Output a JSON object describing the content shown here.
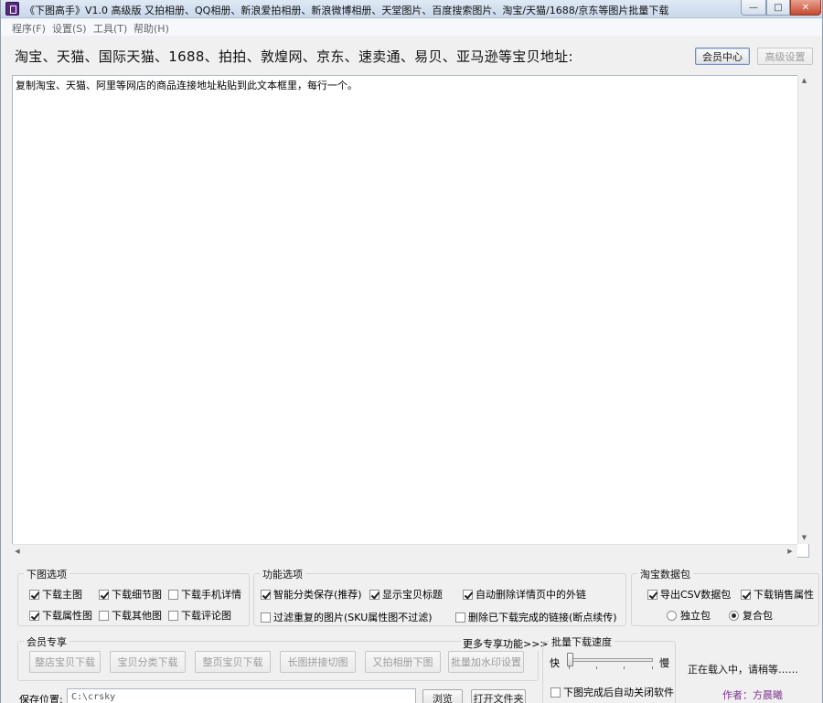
{
  "window": {
    "title": "《下图高手》V1.0  高级版  又拍相册、QQ相册、新浪爱拍相册、新浪微博相册、天堂图片、百度搜索图片、淘宝/天猫/1688/京东等图片批量下载",
    "controls": {
      "minimize": "—",
      "maximize": "□",
      "close": "✕"
    }
  },
  "menu": [
    "程序(F)",
    "设置(S)",
    "工具(T)",
    "帮助(H)"
  ],
  "header": {
    "url_label": "淘宝、天猫、国际天猫、1688、拍拍、敦煌网、京东、速卖通、易贝、亚马逊等宝贝地址:",
    "member_center": "会员中心",
    "advanced_settings": "高级设置"
  },
  "editor": {
    "text": "复制淘宝、天猫、阿里等网店的商品连接地址粘贴到此文本框里，每行一个。",
    "scroll_up": "▲",
    "scroll_down": "▼",
    "scroll_left": "◀",
    "scroll_right": "▶"
  },
  "download_options": {
    "title": "下图选项",
    "items": [
      {
        "label": "下载主图",
        "checked": true
      },
      {
        "label": "下载细节图",
        "checked": true
      },
      {
        "label": "下载手机详情",
        "checked": false
      },
      {
        "label": "下载属性图",
        "checked": true
      },
      {
        "label": "下载其他图",
        "checked": false
      },
      {
        "label": "下载评论图",
        "checked": false
      }
    ]
  },
  "function_options": {
    "title": "功能选项",
    "items": [
      {
        "label": "智能分类保存(推荐)",
        "checked": true
      },
      {
        "label": "显示宝贝标题",
        "checked": true
      },
      {
        "label": "自动删除详情页中的外链",
        "checked": true
      },
      {
        "label": "过滤重复的图片(SKU属性图不过滤)",
        "checked": false
      },
      {
        "label": "删除已下载完成的链接(断点续传)",
        "checked": false
      }
    ]
  },
  "taobao_package": {
    "title": "淘宝数据包",
    "items": [
      {
        "label": "导出CSV数据包",
        "checked": true
      },
      {
        "label": "下载销售属性",
        "checked": true
      }
    ],
    "radios": [
      {
        "label": "独立包",
        "selected": false
      },
      {
        "label": "复合包",
        "selected": true
      }
    ]
  },
  "member_exclusive": {
    "title": "会员专享",
    "more": "更多专享功能>>>",
    "buttons": [
      "整店宝贝下载",
      "宝贝分类下载",
      "整页宝贝下载",
      "长图拼接切图",
      "又拍相册下图",
      "批量加水印设置"
    ]
  },
  "speed": {
    "title": "批量下载速度",
    "fast": "快",
    "slow": "慢",
    "level": 0.0,
    "auto_close": {
      "label": "下图完成后自动关闭软件",
      "checked": false
    }
  },
  "status": {
    "loading": "正在载入中，请稍等……",
    "author": "作者：方晨曦"
  },
  "save": {
    "label": "保存位置:",
    "path": "C:\\crsky",
    "browse": "浏览",
    "open_folder": "打开文件夹"
  },
  "colors": {
    "author": "#7b2f8a",
    "accent": "#5a2a82"
  }
}
